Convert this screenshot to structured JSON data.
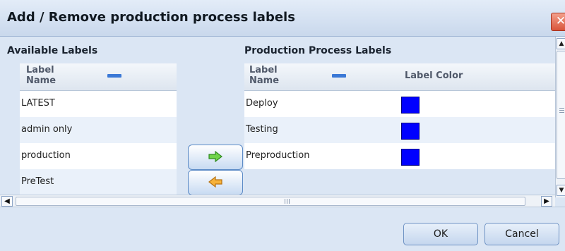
{
  "dialog": {
    "title": "Add / Remove production process labels",
    "close_glyph": "✕"
  },
  "available": {
    "section_title": "Available Labels",
    "header_label": "Label\nName",
    "rows": [
      {
        "name": "LATEST"
      },
      {
        "name": "admin only"
      },
      {
        "name": "production"
      },
      {
        "name": "PreTest"
      }
    ]
  },
  "production": {
    "section_title": "Production Process Labels",
    "header_label": "Label\nName",
    "header_color": "Label Color",
    "rows": [
      {
        "name": "Deploy",
        "color": "#0000ff"
      },
      {
        "name": "Testing",
        "color": "#0000ff"
      },
      {
        "name": "Preproduction",
        "color": "#0000ff"
      }
    ]
  },
  "transfer": {
    "add_icon": "arrow-right-green-icon",
    "remove_icon": "arrow-left-orange-icon"
  },
  "footer": {
    "ok_label": "OK",
    "cancel_label": "Cancel"
  },
  "colors": {
    "accent": "#3a78d6",
    "swatch": "#0000ff",
    "close": "#d9543a"
  }
}
